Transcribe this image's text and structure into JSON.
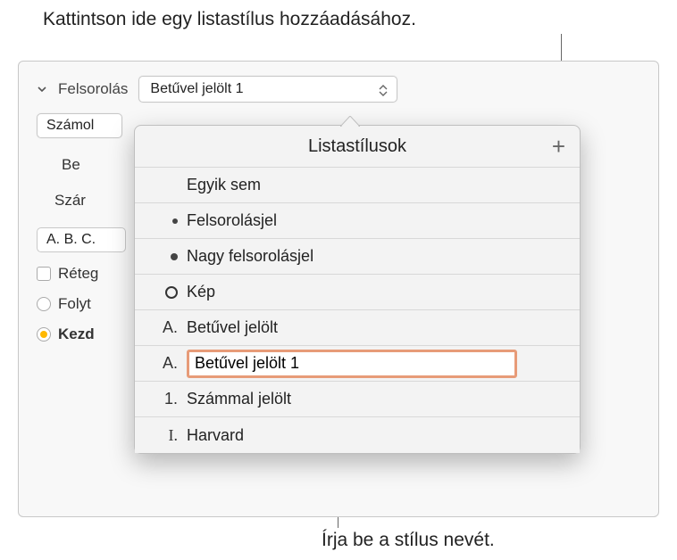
{
  "callouts": {
    "top": "Kattintson ide egy listastílus hozzáadásához.",
    "bottom": "Írja be a stílus nevét."
  },
  "sidebar": {
    "felsorolas_label": "Felsorolás",
    "style_selected": "Betűvel jelölt 1",
    "szamol_partial": "Számol",
    "be_partial": "Be",
    "szam_partial": "Szár",
    "abc_chip": "A. B. C.",
    "reteg_partial": "Réteg",
    "folyt_partial": "Folyt",
    "kezd_partial": "Kezd"
  },
  "popover": {
    "title": "Listastílusok",
    "add_glyph": "+",
    "items": [
      {
        "marker_type": "none",
        "marker": "",
        "label": "Egyik sem"
      },
      {
        "marker_type": "dot",
        "marker": "",
        "label": "Felsorolásjel"
      },
      {
        "marker_type": "dot-lg",
        "marker": "",
        "label": "Nagy felsorolásjel"
      },
      {
        "marker_type": "img",
        "marker": "",
        "label": "Kép"
      },
      {
        "marker_type": "text",
        "marker": "A.",
        "label": "Betűvel jelölt"
      },
      {
        "marker_type": "edit",
        "marker": "A.",
        "label": "Betűvel jelölt 1"
      },
      {
        "marker_type": "text",
        "marker": "1.",
        "label": "Számmal jelölt"
      },
      {
        "marker_type": "roman",
        "marker": "I.",
        "label": "Harvard"
      }
    ]
  },
  "colors": {
    "edit_border": "#e79b78",
    "radio_selected": "#ffb800"
  }
}
